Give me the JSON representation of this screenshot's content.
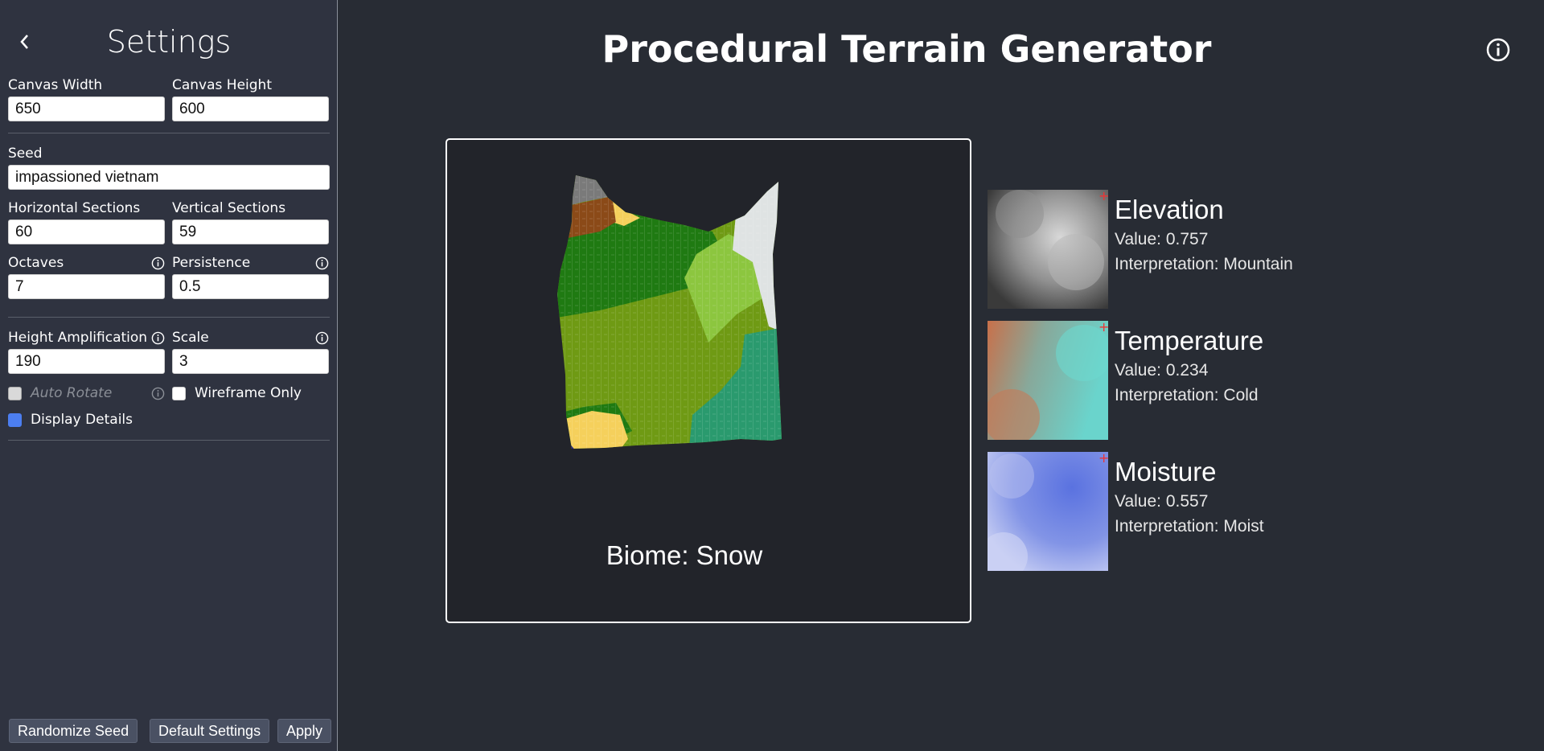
{
  "sidebar": {
    "title": "Settings",
    "canvas_width": {
      "label": "Canvas Width",
      "value": "650"
    },
    "canvas_height": {
      "label": "Canvas Height",
      "value": "600"
    },
    "seed": {
      "label": "Seed",
      "value": "impassioned vietnam"
    },
    "horizontal_sections": {
      "label": "Horizontal Sections",
      "value": "60"
    },
    "vertical_sections": {
      "label": "Vertical Sections",
      "value": "59"
    },
    "octaves": {
      "label": "Octaves",
      "value": "7"
    },
    "persistence": {
      "label": "Persistence",
      "value": "0.5"
    },
    "height_amplification": {
      "label": "Height Amplification",
      "value": "190"
    },
    "scale": {
      "label": "Scale",
      "value": "3"
    },
    "auto_rotate": {
      "label": "Auto Rotate",
      "checked": false,
      "disabled": true
    },
    "wireframe_only": {
      "label": "Wireframe Only",
      "checked": false
    },
    "display_details": {
      "label": "Display Details",
      "checked": true
    },
    "buttons": {
      "randomize": "Randomize Seed",
      "defaults": "Default Settings",
      "apply": "Apply"
    }
  },
  "main": {
    "title": "Procedural Terrain Generator",
    "biome_label": "Biome: Snow"
  },
  "noise_maps": [
    {
      "title": "Elevation",
      "value": "Value: 0.757",
      "interpretation": "Interpretation: Mountain"
    },
    {
      "title": "Temperature",
      "value": "Value: 0.234",
      "interpretation": "Interpretation: Cold"
    },
    {
      "title": "Moisture",
      "value": "Value: 0.557",
      "interpretation": "Interpretation: Moist"
    }
  ],
  "colors": {
    "background": "#282c34",
    "sidebar": "#2f3340",
    "accent": "#4c7ef0",
    "forest": "#1f7a12",
    "grassland": "#6f9a14",
    "light_grass": "#8cc63f",
    "snow": "#dfe3e3",
    "tundra": "#2a9a6e",
    "sand": "#f5d05c",
    "dirt": "#8b4a18",
    "rock": "#7a7a7a"
  }
}
